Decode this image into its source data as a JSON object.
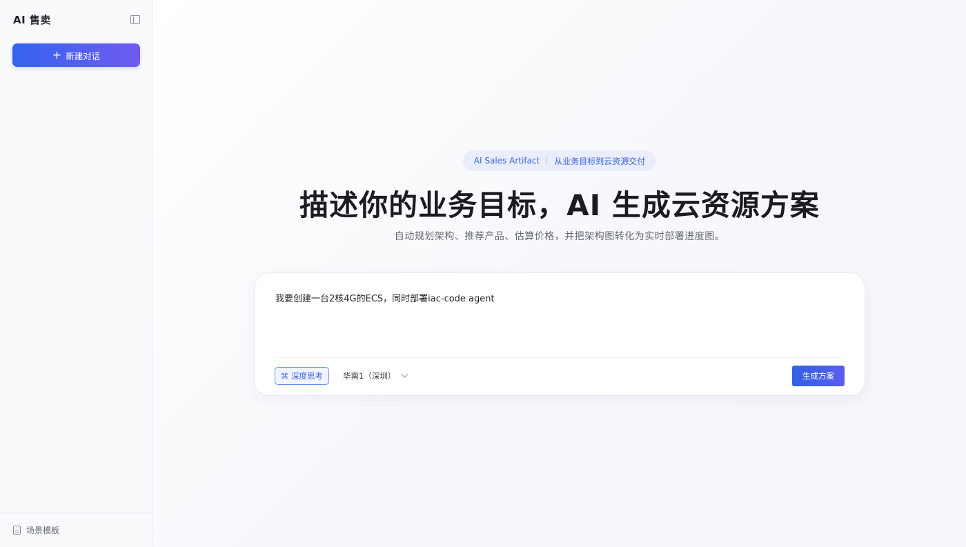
{
  "sidebar": {
    "brand": "AI 售卖",
    "collapse_icon": "sidebar-collapse-icon",
    "new_chat": {
      "icon": "plus",
      "label": "新建对话"
    },
    "footer": {
      "icon": "file-template-icon",
      "label": "场景模板"
    }
  },
  "hero": {
    "badge_left": "AI Sales Artifact",
    "badge_right": "从业务目标到云资源交付",
    "title": "描述你的业务目标，AI 生成云资源方案",
    "subtitle": "自动规划架构、推荐产品、估算价格，并把架构图转化为实时部署进度图。"
  },
  "composer": {
    "prompt": "我要创建一台2核4G的ECS，同时部署iac-code agent",
    "deep_think": {
      "icon": "atom-icon",
      "label": "深度思考"
    },
    "region": {
      "selected": "华南1（深圳）"
    },
    "submit": "生成方案"
  },
  "colors": {
    "accent": "#3563ee",
    "accent_gradient_end": "#6f5cf0",
    "badge_bg": "#eaedfb"
  }
}
